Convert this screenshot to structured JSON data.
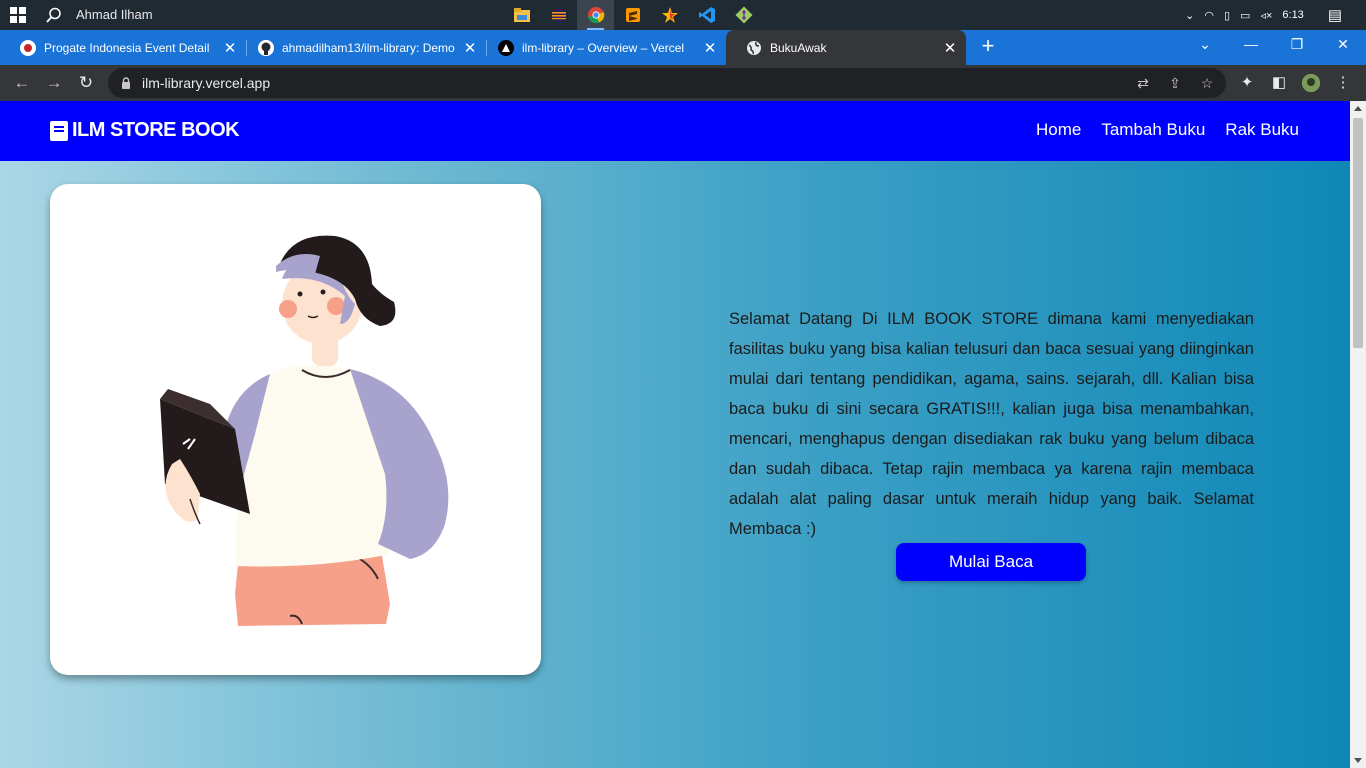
{
  "taskbar": {
    "user": "Ahmad Ilham",
    "clock": "6:13",
    "apps": [
      "file-explorer-icon",
      "eclipse-icon",
      "chrome-icon",
      "sublime-icon",
      "star-app-icon",
      "vscode-icon",
      "git-icon"
    ]
  },
  "tabs": [
    {
      "title": "Progate Indonesia Event Detail",
      "icon": "progate-icon"
    },
    {
      "title": "ahmadilham13/ilm-library: Demo",
      "icon": "github-icon"
    },
    {
      "title": "ilm-library – Overview – Vercel",
      "icon": "vercel-icon"
    },
    {
      "title": "BukuAwak",
      "icon": "globe-icon"
    }
  ],
  "omnibox": {
    "url": "ilm-library.vercel.app"
  },
  "site": {
    "brand": "ILM STORE BOOK",
    "nav": [
      "Home",
      "Tambah Buku",
      "Rak Buku"
    ],
    "intro": "Selamat Datang Di ILM BOOK STORE dimana kami menyediakan fasilitas buku yang bisa kalian telusuri dan baca sesuai yang diinginkan mulai dari tentang pendidikan, agama, sains. sejarah, dll. Kalian bisa baca buku di sini secara GRATIS!!!, kalian juga bisa menambahkan, mencari, menghapus dengan disediakan rak buku yang belum dibaca dan sudah dibaca. Tetap rajin membaca ya karena rajin membaca adalah alat paling dasar untuk meraih hidup yang baik. Selamat Membaca :)",
    "cta": "Mulai Baca"
  },
  "colors": {
    "nav_bg": "#0000ff",
    "tabstrip": "#1a73d6",
    "toolbar": "#35363a"
  }
}
